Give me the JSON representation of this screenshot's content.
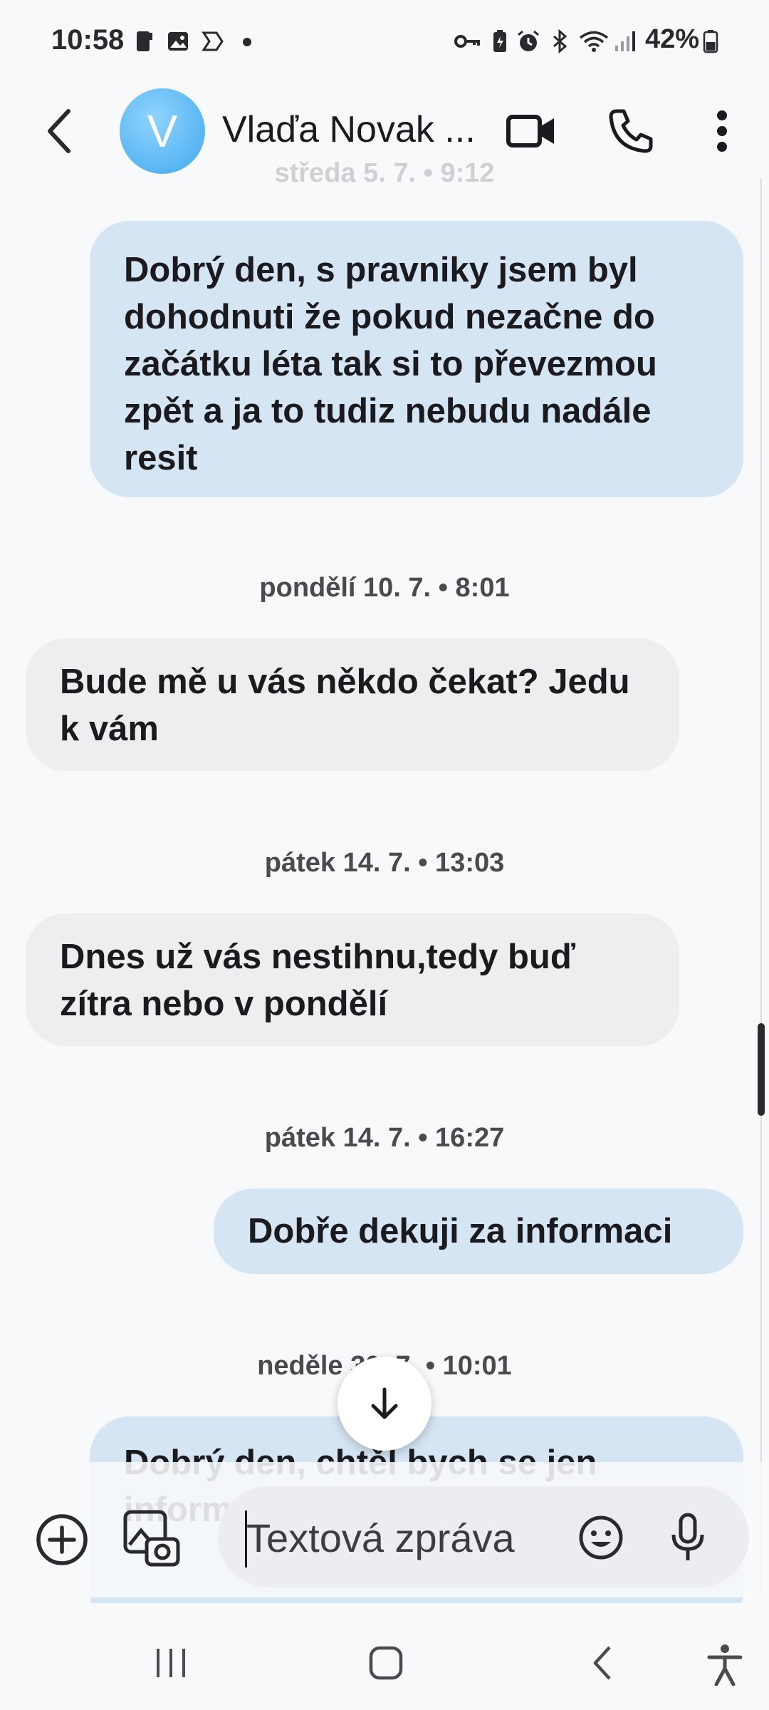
{
  "status_bar": {
    "time": "10:58",
    "battery": "42%"
  },
  "header": {
    "avatar_letter": "V",
    "contact_name": "Vlaďa Novak ...",
    "back_icon": "back-arrow-icon",
    "video_call_icon": "video-camera-icon",
    "call_icon": "phone-icon",
    "menu_icon": "more-vertical-icon"
  },
  "conversation": {
    "top_timestamp": "středa 5. 7. • 9:12",
    "messages": [
      {
        "direction": "out",
        "text": "Dobrý den,  s pravniky jsem byl dohodnuti že pokud nezačne do začátku léta tak si to převezmou zpět a ja to tudiz nebudu nadále resit"
      },
      {
        "timestamp": "pondělí 10. 7. • 8:01",
        "direction": "in",
        "text": "Bude mě u vás někdo čekat? Jedu k  vám"
      },
      {
        "timestamp": "pátek 14. 7. • 13:03",
        "direction": "in",
        "text": "Dnes už vás nestihnu,tedy buď zítra nebo v pondělí"
      },
      {
        "timestamp": "pátek 14. 7. • 16:27",
        "direction": "out",
        "text": "Dobře dekuji za informaci"
      },
      {
        "timestamp": "neděle 30. 7. • 10:01",
        "direction": "out",
        "text": "Dobrý den,  chtěl bych se jen informovat, jestli už něco víte"
      }
    ]
  },
  "composer": {
    "placeholder": "Textová zpráva",
    "add_icon": "plus-circle-icon",
    "gallery_icon": "gallery-camera-icon",
    "emoji_icon": "emoji-icon",
    "mic_icon": "microphone-icon"
  },
  "nav_bar": {
    "recents_icon": "recents-icon",
    "home_icon": "home-icon",
    "back_icon": "nav-back-icon",
    "accessibility_icon": "accessibility-icon"
  },
  "colors": {
    "outgoing_bubble": "#d5e5f4",
    "incoming_bubble": "#eeeef0",
    "background": "#f8f9fb",
    "avatar": "#59b6f3"
  }
}
